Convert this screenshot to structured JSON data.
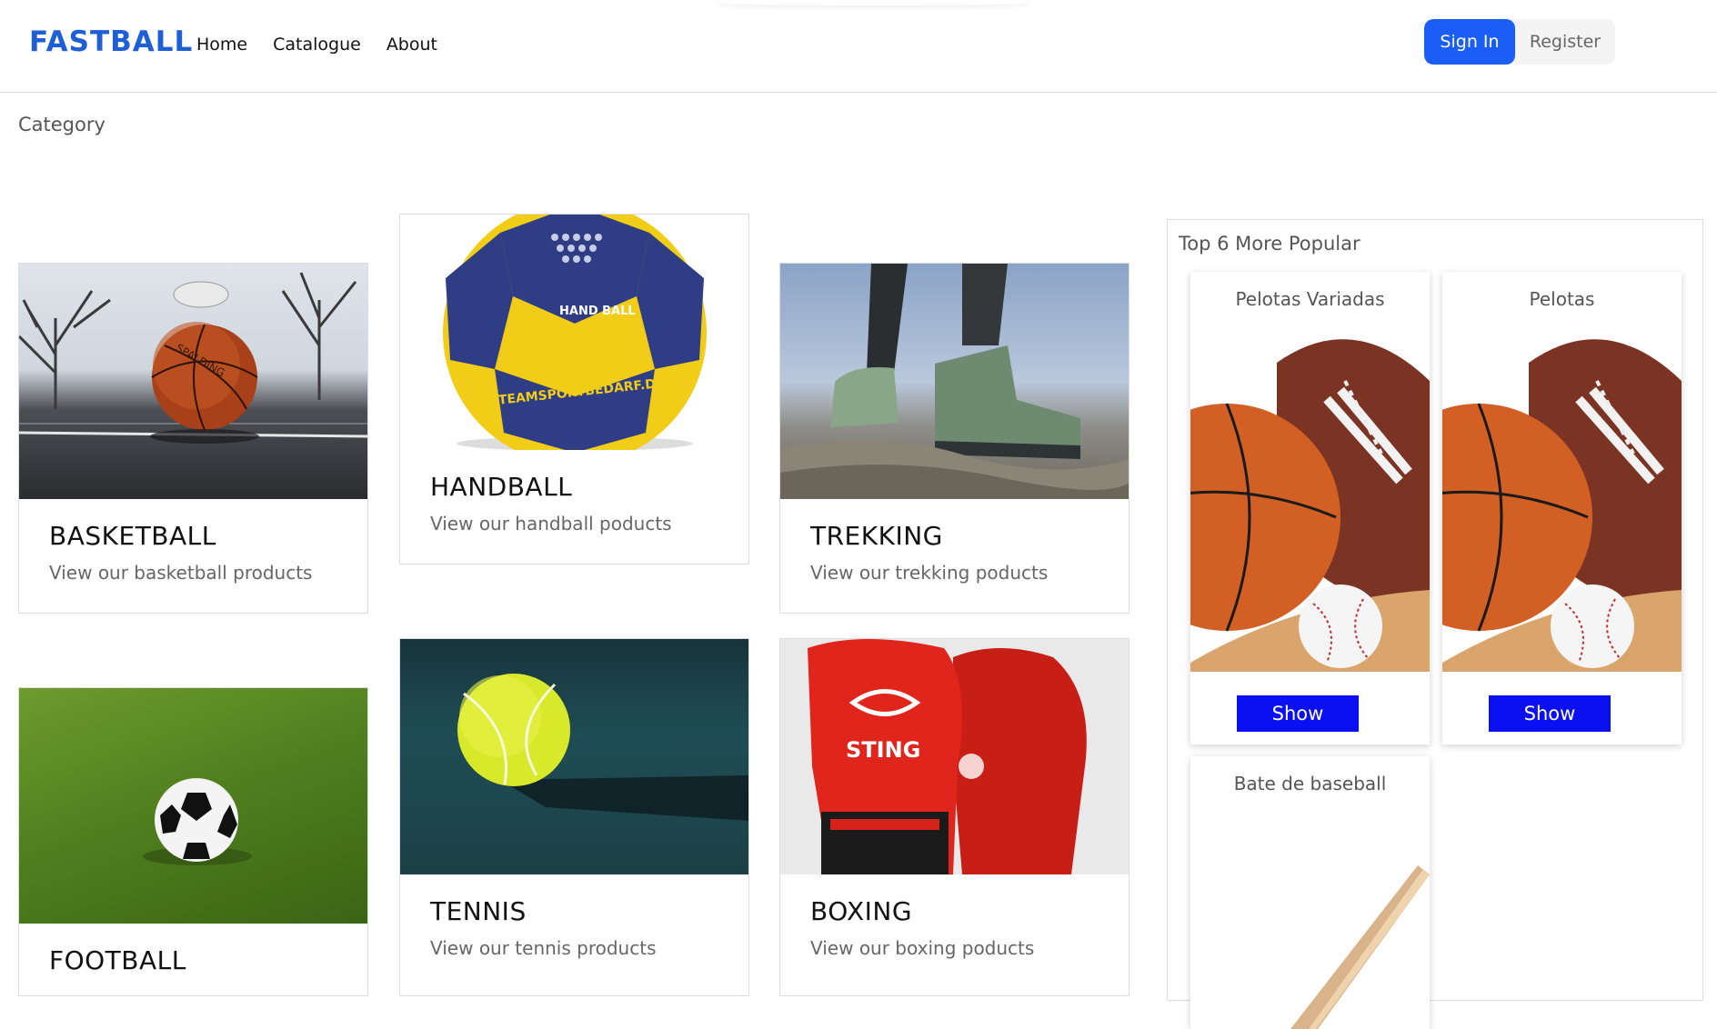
{
  "header": {
    "logo": "FASTBALL",
    "nav": [
      "Home",
      "Catalogue",
      "About"
    ],
    "sign_in": "Sign In",
    "register": "Register",
    "brand_color": "#1a5ef5"
  },
  "page": {
    "category_label": "Category"
  },
  "categories": [
    {
      "title": "BASKETBALL",
      "desc": "View our basketball products"
    },
    {
      "title": "HANDBALL",
      "desc": "View our handball poducts"
    },
    {
      "title": "TREKKING",
      "desc": "View our trekking poducts"
    },
    {
      "title": "FOOTBALL",
      "desc": ""
    },
    {
      "title": "TENNIS",
      "desc": "View our tennis products"
    },
    {
      "title": "BOXING",
      "desc": "View our boxing poducts"
    }
  ],
  "sidebar": {
    "title": "Top 6 More Popular",
    "products": [
      {
        "name": "Pelotas Variadas",
        "button": "Show"
      },
      {
        "name": "Pelotas",
        "button": "Show"
      },
      {
        "name": "Bate de baseball",
        "button": ""
      }
    ],
    "show_button_color": "#0b10f2"
  },
  "images": {
    "handball_text": "HAND BALL",
    "handball_brand": "TEAMSPORTBEDARF.DE",
    "basketball_brand": "SPALDING",
    "boxing_brand": "STING"
  }
}
